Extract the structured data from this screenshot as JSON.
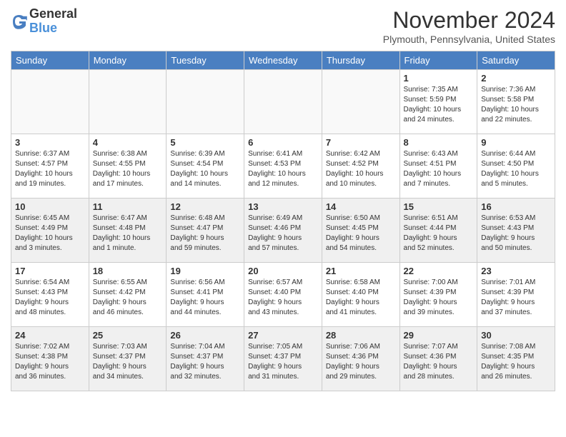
{
  "header": {
    "logo_general": "General",
    "logo_blue": "Blue",
    "title": "November 2024",
    "location": "Plymouth, Pennsylvania, United States"
  },
  "days_of_week": [
    "Sunday",
    "Monday",
    "Tuesday",
    "Wednesday",
    "Thursday",
    "Friday",
    "Saturday"
  ],
  "weeks": [
    [
      {
        "day": "",
        "info": "",
        "empty": true
      },
      {
        "day": "",
        "info": "",
        "empty": true
      },
      {
        "day": "",
        "info": "",
        "empty": true
      },
      {
        "day": "",
        "info": "",
        "empty": true
      },
      {
        "day": "",
        "info": "",
        "empty": true
      },
      {
        "day": "1",
        "info": "Sunrise: 7:35 AM\nSunset: 5:59 PM\nDaylight: 10 hours\nand 24 minutes."
      },
      {
        "day": "2",
        "info": "Sunrise: 7:36 AM\nSunset: 5:58 PM\nDaylight: 10 hours\nand 22 minutes."
      }
    ],
    [
      {
        "day": "3",
        "info": "Sunrise: 6:37 AM\nSunset: 4:57 PM\nDaylight: 10 hours\nand 19 minutes."
      },
      {
        "day": "4",
        "info": "Sunrise: 6:38 AM\nSunset: 4:55 PM\nDaylight: 10 hours\nand 17 minutes."
      },
      {
        "day": "5",
        "info": "Sunrise: 6:39 AM\nSunset: 4:54 PM\nDaylight: 10 hours\nand 14 minutes."
      },
      {
        "day": "6",
        "info": "Sunrise: 6:41 AM\nSunset: 4:53 PM\nDaylight: 10 hours\nand 12 minutes."
      },
      {
        "day": "7",
        "info": "Sunrise: 6:42 AM\nSunset: 4:52 PM\nDaylight: 10 hours\nand 10 minutes."
      },
      {
        "day": "8",
        "info": "Sunrise: 6:43 AM\nSunset: 4:51 PM\nDaylight: 10 hours\nand 7 minutes."
      },
      {
        "day": "9",
        "info": "Sunrise: 6:44 AM\nSunset: 4:50 PM\nDaylight: 10 hours\nand 5 minutes."
      }
    ],
    [
      {
        "day": "10",
        "info": "Sunrise: 6:45 AM\nSunset: 4:49 PM\nDaylight: 10 hours\nand 3 minutes."
      },
      {
        "day": "11",
        "info": "Sunrise: 6:47 AM\nSunset: 4:48 PM\nDaylight: 10 hours\nand 1 minute."
      },
      {
        "day": "12",
        "info": "Sunrise: 6:48 AM\nSunset: 4:47 PM\nDaylight: 9 hours\nand 59 minutes."
      },
      {
        "day": "13",
        "info": "Sunrise: 6:49 AM\nSunset: 4:46 PM\nDaylight: 9 hours\nand 57 minutes."
      },
      {
        "day": "14",
        "info": "Sunrise: 6:50 AM\nSunset: 4:45 PM\nDaylight: 9 hours\nand 54 minutes."
      },
      {
        "day": "15",
        "info": "Sunrise: 6:51 AM\nSunset: 4:44 PM\nDaylight: 9 hours\nand 52 minutes."
      },
      {
        "day": "16",
        "info": "Sunrise: 6:53 AM\nSunset: 4:43 PM\nDaylight: 9 hours\nand 50 minutes."
      }
    ],
    [
      {
        "day": "17",
        "info": "Sunrise: 6:54 AM\nSunset: 4:43 PM\nDaylight: 9 hours\nand 48 minutes."
      },
      {
        "day": "18",
        "info": "Sunrise: 6:55 AM\nSunset: 4:42 PM\nDaylight: 9 hours\nand 46 minutes."
      },
      {
        "day": "19",
        "info": "Sunrise: 6:56 AM\nSunset: 4:41 PM\nDaylight: 9 hours\nand 44 minutes."
      },
      {
        "day": "20",
        "info": "Sunrise: 6:57 AM\nSunset: 4:40 PM\nDaylight: 9 hours\nand 43 minutes."
      },
      {
        "day": "21",
        "info": "Sunrise: 6:58 AM\nSunset: 4:40 PM\nDaylight: 9 hours\nand 41 minutes."
      },
      {
        "day": "22",
        "info": "Sunrise: 7:00 AM\nSunset: 4:39 PM\nDaylight: 9 hours\nand 39 minutes."
      },
      {
        "day": "23",
        "info": "Sunrise: 7:01 AM\nSunset: 4:39 PM\nDaylight: 9 hours\nand 37 minutes."
      }
    ],
    [
      {
        "day": "24",
        "info": "Sunrise: 7:02 AM\nSunset: 4:38 PM\nDaylight: 9 hours\nand 36 minutes."
      },
      {
        "day": "25",
        "info": "Sunrise: 7:03 AM\nSunset: 4:37 PM\nDaylight: 9 hours\nand 34 minutes."
      },
      {
        "day": "26",
        "info": "Sunrise: 7:04 AM\nSunset: 4:37 PM\nDaylight: 9 hours\nand 32 minutes."
      },
      {
        "day": "27",
        "info": "Sunrise: 7:05 AM\nSunset: 4:37 PM\nDaylight: 9 hours\nand 31 minutes."
      },
      {
        "day": "28",
        "info": "Sunrise: 7:06 AM\nSunset: 4:36 PM\nDaylight: 9 hours\nand 29 minutes."
      },
      {
        "day": "29",
        "info": "Sunrise: 7:07 AM\nSunset: 4:36 PM\nDaylight: 9 hours\nand 28 minutes."
      },
      {
        "day": "30",
        "info": "Sunrise: 7:08 AM\nSunset: 4:35 PM\nDaylight: 9 hours\nand 26 minutes."
      }
    ]
  ]
}
